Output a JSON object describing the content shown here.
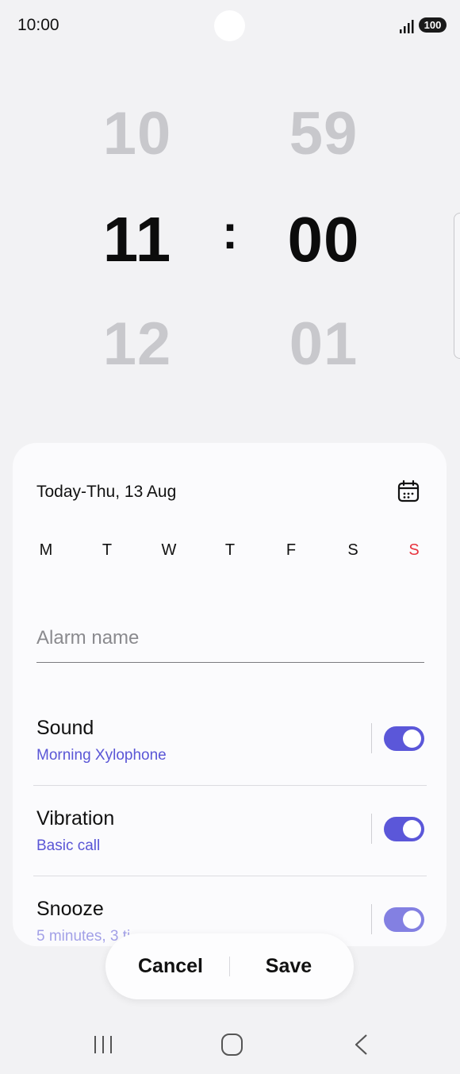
{
  "status_bar": {
    "time": "10:00",
    "battery": "100"
  },
  "picker": {
    "hour_prev": "10",
    "hour": "11",
    "hour_next": "12",
    "separator": ":",
    "minute_prev": "59",
    "minute": "00",
    "minute_next": "01"
  },
  "schedule": {
    "date": "Today-Thu, 13 Aug",
    "days": [
      "M",
      "T",
      "W",
      "T",
      "F",
      "S",
      "S"
    ]
  },
  "alarm_name": {
    "placeholder": "Alarm name"
  },
  "settings": [
    {
      "title": "Sound",
      "subtitle": "Morning Xylophone",
      "enabled": true
    },
    {
      "title": "Vibration",
      "subtitle": "Basic call",
      "enabled": true
    },
    {
      "title": "Snooze",
      "subtitle": "5 minutes, 3 ti",
      "enabled": true
    }
  ],
  "actions": {
    "cancel": "Cancel",
    "save": "Save"
  },
  "colors": {
    "accent": "#5b57d9",
    "sunday": "#e8343f",
    "background": "#f2f2f4"
  },
  "icons": {
    "calendar": "calendar-icon",
    "recents": "recents-icon",
    "home": "home-icon",
    "back": "back-icon"
  }
}
